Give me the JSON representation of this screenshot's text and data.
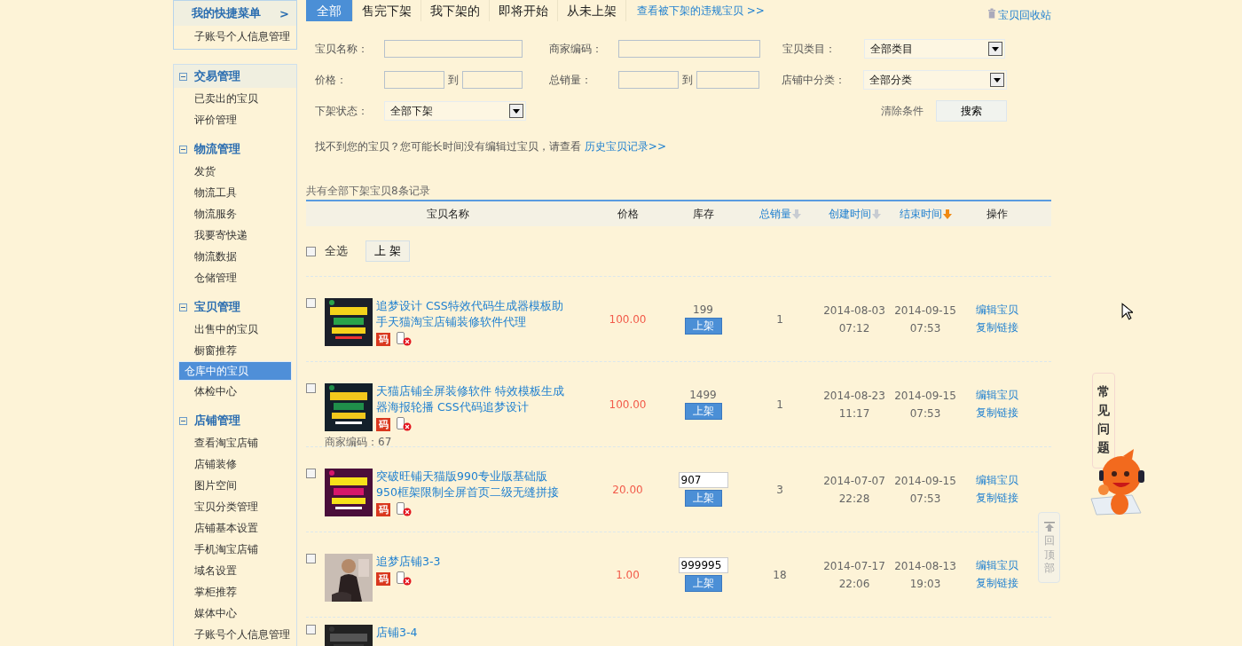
{
  "sidebar": {
    "quick_menu": {
      "title": "我的快捷菜单",
      "arrow": ">",
      "items": [
        "子账号个人信息管理"
      ]
    },
    "groups": [
      {
        "title": "交易管理",
        "expanded": true,
        "items": [
          {
            "label": "已卖出的宝贝",
            "selected": false
          },
          {
            "label": "评价管理",
            "selected": false
          }
        ]
      },
      {
        "title": "物流管理",
        "expanded": true,
        "items": [
          {
            "label": "发货",
            "selected": false
          },
          {
            "label": "物流工具",
            "selected": false
          },
          {
            "label": "物流服务",
            "selected": false
          },
          {
            "label": "我要寄快递",
            "selected": false
          },
          {
            "label": "物流数据",
            "selected": false
          },
          {
            "label": "仓储管理",
            "selected": false
          }
        ]
      },
      {
        "title": "宝贝管理",
        "expanded": true,
        "items": [
          {
            "label": "出售中的宝贝",
            "selected": false
          },
          {
            "label": "橱窗推荐",
            "selected": false
          },
          {
            "label": "仓库中的宝贝",
            "selected": true
          },
          {
            "label": "体检中心",
            "selected": false
          }
        ]
      },
      {
        "title": "店铺管理",
        "expanded": true,
        "items": [
          {
            "label": "查看淘宝店铺",
            "selected": false
          },
          {
            "label": "店铺装修",
            "selected": false
          },
          {
            "label": "图片空间",
            "selected": false
          },
          {
            "label": "宝贝分类管理",
            "selected": false
          },
          {
            "label": "店铺基本设置",
            "selected": false
          },
          {
            "label": "手机淘宝店铺",
            "selected": false
          },
          {
            "label": "域名设置",
            "selected": false
          },
          {
            "label": "掌柜推荐",
            "selected": false
          },
          {
            "label": "媒体中心",
            "selected": false
          },
          {
            "label": "子账号个人信息管理",
            "selected": false
          }
        ]
      }
    ]
  },
  "tabs": [
    {
      "label": "全部",
      "selected": true
    },
    {
      "label": "售完下架",
      "selected": false
    },
    {
      "label": "我下架的",
      "selected": false
    },
    {
      "label": "即将开始",
      "selected": false
    },
    {
      "label": "从未上架",
      "selected": false
    }
  ],
  "violation_link": "查看被下架的违规宝贝 >>",
  "recycle_link": "宝贝回收站",
  "filters": {
    "name_label": "宝贝名称：",
    "code_label": "商家编码：",
    "category_label": "宝贝类目：",
    "category_value": "全部类目",
    "price_label": "价格：",
    "to_1": "到",
    "sales_label": "总销量：",
    "to_2": "到",
    "shop_category_label": "店铺中分类：",
    "shop_category_value": "全部分类",
    "status_label": "下架状态：",
    "status_value": "全部下架",
    "clear": "清除条件",
    "search": "搜索"
  },
  "hint": {
    "text": "找不到您的宝贝？您可能长时间没有编辑过宝贝，请查看",
    "link": "历史宝贝记录>>"
  },
  "summary": "共有全部下架宝贝8条记录",
  "columns": [
    {
      "label": "宝贝名称",
      "kind": "plain"
    },
    {
      "label": "价格",
      "kind": "plain"
    },
    {
      "label": "库存",
      "kind": "plain"
    },
    {
      "label": "总销量",
      "kind": "sort",
      "sorted": false
    },
    {
      "label": "创建时间",
      "kind": "sort",
      "sorted": false
    },
    {
      "label": "结束时间",
      "kind": "sort",
      "sorted": true
    },
    {
      "label": "操作",
      "kind": "plain"
    }
  ],
  "select_all": {
    "label": "全选",
    "checked": false,
    "button": "上 架"
  },
  "rows": [
    {
      "checked": false,
      "title": "追梦设计 CSS特效代码生成器模板助手天猫淘宝店铺装修软件代理",
      "code_badge": "码",
      "price": "100.00",
      "stock": {
        "kind": "text",
        "value": "199"
      },
      "list_button": "上架",
      "sales": "1",
      "created": [
        "2014-08-03",
        "07:12"
      ],
      "ends": [
        "2014-09-15",
        "07:53"
      ],
      "actions": [
        "编辑宝贝",
        "复制链接"
      ]
    },
    {
      "checked": false,
      "title": "天猫店铺全屏装修软件 特效模板生成器海报轮播 CSS代码追梦设计",
      "code_badge": "码",
      "merchant_code": "商家编码：67",
      "price": "100.00",
      "stock": {
        "kind": "text",
        "value": "1499"
      },
      "list_button": "上架",
      "sales": "1",
      "created": [
        "2014-08-23",
        "11:17"
      ],
      "ends": [
        "2014-09-15",
        "07:53"
      ],
      "actions": [
        "编辑宝贝",
        "复制链接"
      ]
    },
    {
      "checked": false,
      "title": "突破旺铺天猫版990专业版基础版950框架限制全屏首页二级无缝拼接",
      "code_badge": "码",
      "price": "20.00",
      "stock": {
        "kind": "input",
        "value": "907"
      },
      "list_button": "上架",
      "sales": "3",
      "created": [
        "2014-07-07",
        "22:28"
      ],
      "ends": [
        "2014-09-15",
        "07:53"
      ],
      "actions": [
        "编辑宝贝",
        "复制链接"
      ]
    },
    {
      "checked": false,
      "title": "追梦店铺3-3",
      "code_badge": "码",
      "price": "1.00",
      "stock": {
        "kind": "input",
        "value": "999995"
      },
      "list_button": "上架",
      "sales": "18",
      "created": [
        "2014-07-17",
        "22:06"
      ],
      "ends": [
        "2014-08-13",
        "19:03"
      ],
      "actions": [
        "编辑宝贝",
        "复制链接"
      ]
    },
    {
      "checked": false,
      "title": "店铺3-4"
    }
  ],
  "faq": "常见问题",
  "back_to_top": "回顶部"
}
